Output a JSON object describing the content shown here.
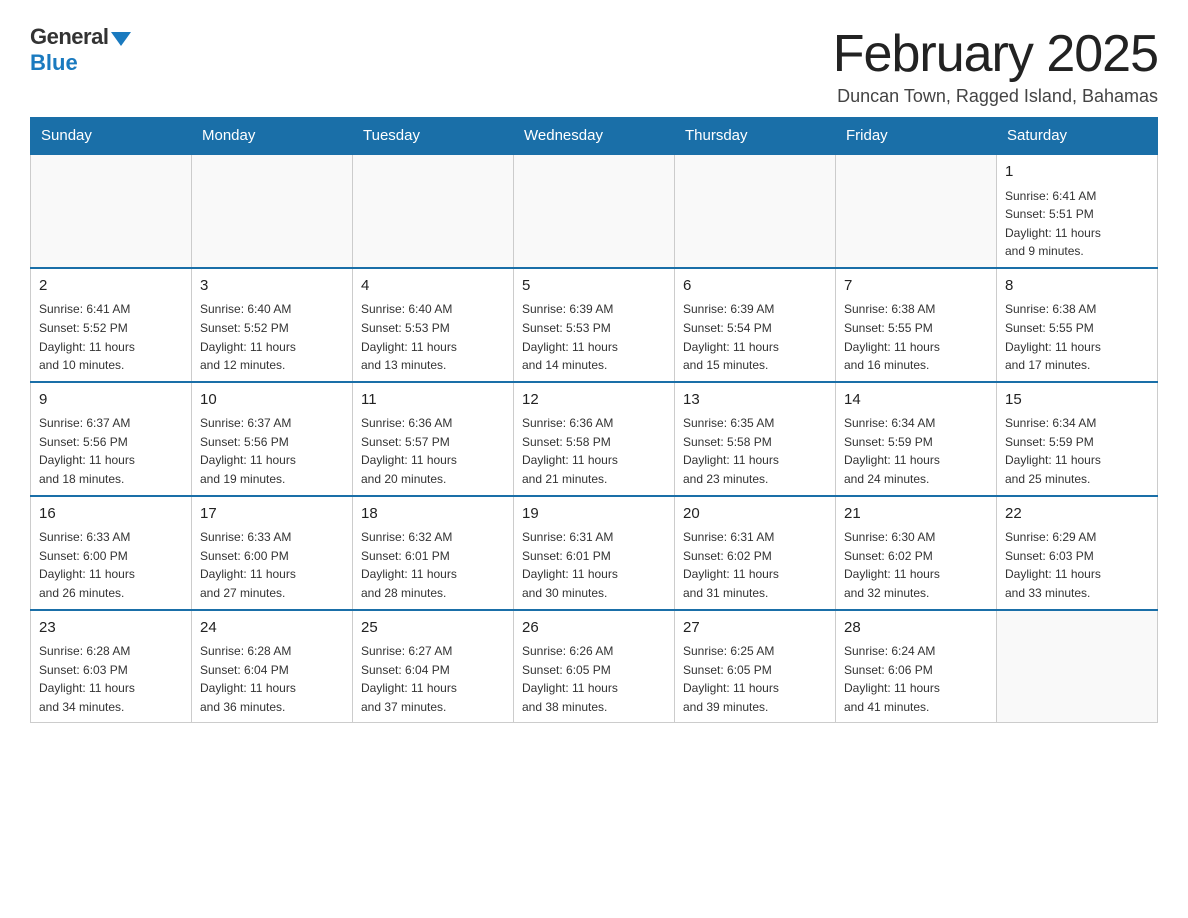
{
  "logo": {
    "general": "General",
    "blue": "Blue"
  },
  "title": "February 2025",
  "location": "Duncan Town, Ragged Island, Bahamas",
  "days_of_week": [
    "Sunday",
    "Monday",
    "Tuesday",
    "Wednesday",
    "Thursday",
    "Friday",
    "Saturday"
  ],
  "weeks": [
    [
      {
        "day": "",
        "info": ""
      },
      {
        "day": "",
        "info": ""
      },
      {
        "day": "",
        "info": ""
      },
      {
        "day": "",
        "info": ""
      },
      {
        "day": "",
        "info": ""
      },
      {
        "day": "",
        "info": ""
      },
      {
        "day": "1",
        "info": "Sunrise: 6:41 AM\nSunset: 5:51 PM\nDaylight: 11 hours\nand 9 minutes."
      }
    ],
    [
      {
        "day": "2",
        "info": "Sunrise: 6:41 AM\nSunset: 5:52 PM\nDaylight: 11 hours\nand 10 minutes."
      },
      {
        "day": "3",
        "info": "Sunrise: 6:40 AM\nSunset: 5:52 PM\nDaylight: 11 hours\nand 12 minutes."
      },
      {
        "day": "4",
        "info": "Sunrise: 6:40 AM\nSunset: 5:53 PM\nDaylight: 11 hours\nand 13 minutes."
      },
      {
        "day": "5",
        "info": "Sunrise: 6:39 AM\nSunset: 5:53 PM\nDaylight: 11 hours\nand 14 minutes."
      },
      {
        "day": "6",
        "info": "Sunrise: 6:39 AM\nSunset: 5:54 PM\nDaylight: 11 hours\nand 15 minutes."
      },
      {
        "day": "7",
        "info": "Sunrise: 6:38 AM\nSunset: 5:55 PM\nDaylight: 11 hours\nand 16 minutes."
      },
      {
        "day": "8",
        "info": "Sunrise: 6:38 AM\nSunset: 5:55 PM\nDaylight: 11 hours\nand 17 minutes."
      }
    ],
    [
      {
        "day": "9",
        "info": "Sunrise: 6:37 AM\nSunset: 5:56 PM\nDaylight: 11 hours\nand 18 minutes."
      },
      {
        "day": "10",
        "info": "Sunrise: 6:37 AM\nSunset: 5:56 PM\nDaylight: 11 hours\nand 19 minutes."
      },
      {
        "day": "11",
        "info": "Sunrise: 6:36 AM\nSunset: 5:57 PM\nDaylight: 11 hours\nand 20 minutes."
      },
      {
        "day": "12",
        "info": "Sunrise: 6:36 AM\nSunset: 5:58 PM\nDaylight: 11 hours\nand 21 minutes."
      },
      {
        "day": "13",
        "info": "Sunrise: 6:35 AM\nSunset: 5:58 PM\nDaylight: 11 hours\nand 23 minutes."
      },
      {
        "day": "14",
        "info": "Sunrise: 6:34 AM\nSunset: 5:59 PM\nDaylight: 11 hours\nand 24 minutes."
      },
      {
        "day": "15",
        "info": "Sunrise: 6:34 AM\nSunset: 5:59 PM\nDaylight: 11 hours\nand 25 minutes."
      }
    ],
    [
      {
        "day": "16",
        "info": "Sunrise: 6:33 AM\nSunset: 6:00 PM\nDaylight: 11 hours\nand 26 minutes."
      },
      {
        "day": "17",
        "info": "Sunrise: 6:33 AM\nSunset: 6:00 PM\nDaylight: 11 hours\nand 27 minutes."
      },
      {
        "day": "18",
        "info": "Sunrise: 6:32 AM\nSunset: 6:01 PM\nDaylight: 11 hours\nand 28 minutes."
      },
      {
        "day": "19",
        "info": "Sunrise: 6:31 AM\nSunset: 6:01 PM\nDaylight: 11 hours\nand 30 minutes."
      },
      {
        "day": "20",
        "info": "Sunrise: 6:31 AM\nSunset: 6:02 PM\nDaylight: 11 hours\nand 31 minutes."
      },
      {
        "day": "21",
        "info": "Sunrise: 6:30 AM\nSunset: 6:02 PM\nDaylight: 11 hours\nand 32 minutes."
      },
      {
        "day": "22",
        "info": "Sunrise: 6:29 AM\nSunset: 6:03 PM\nDaylight: 11 hours\nand 33 minutes."
      }
    ],
    [
      {
        "day": "23",
        "info": "Sunrise: 6:28 AM\nSunset: 6:03 PM\nDaylight: 11 hours\nand 34 minutes."
      },
      {
        "day": "24",
        "info": "Sunrise: 6:28 AM\nSunset: 6:04 PM\nDaylight: 11 hours\nand 36 minutes."
      },
      {
        "day": "25",
        "info": "Sunrise: 6:27 AM\nSunset: 6:04 PM\nDaylight: 11 hours\nand 37 minutes."
      },
      {
        "day": "26",
        "info": "Sunrise: 6:26 AM\nSunset: 6:05 PM\nDaylight: 11 hours\nand 38 minutes."
      },
      {
        "day": "27",
        "info": "Sunrise: 6:25 AM\nSunset: 6:05 PM\nDaylight: 11 hours\nand 39 minutes."
      },
      {
        "day": "28",
        "info": "Sunrise: 6:24 AM\nSunset: 6:06 PM\nDaylight: 11 hours\nand 41 minutes."
      },
      {
        "day": "",
        "info": ""
      }
    ]
  ]
}
